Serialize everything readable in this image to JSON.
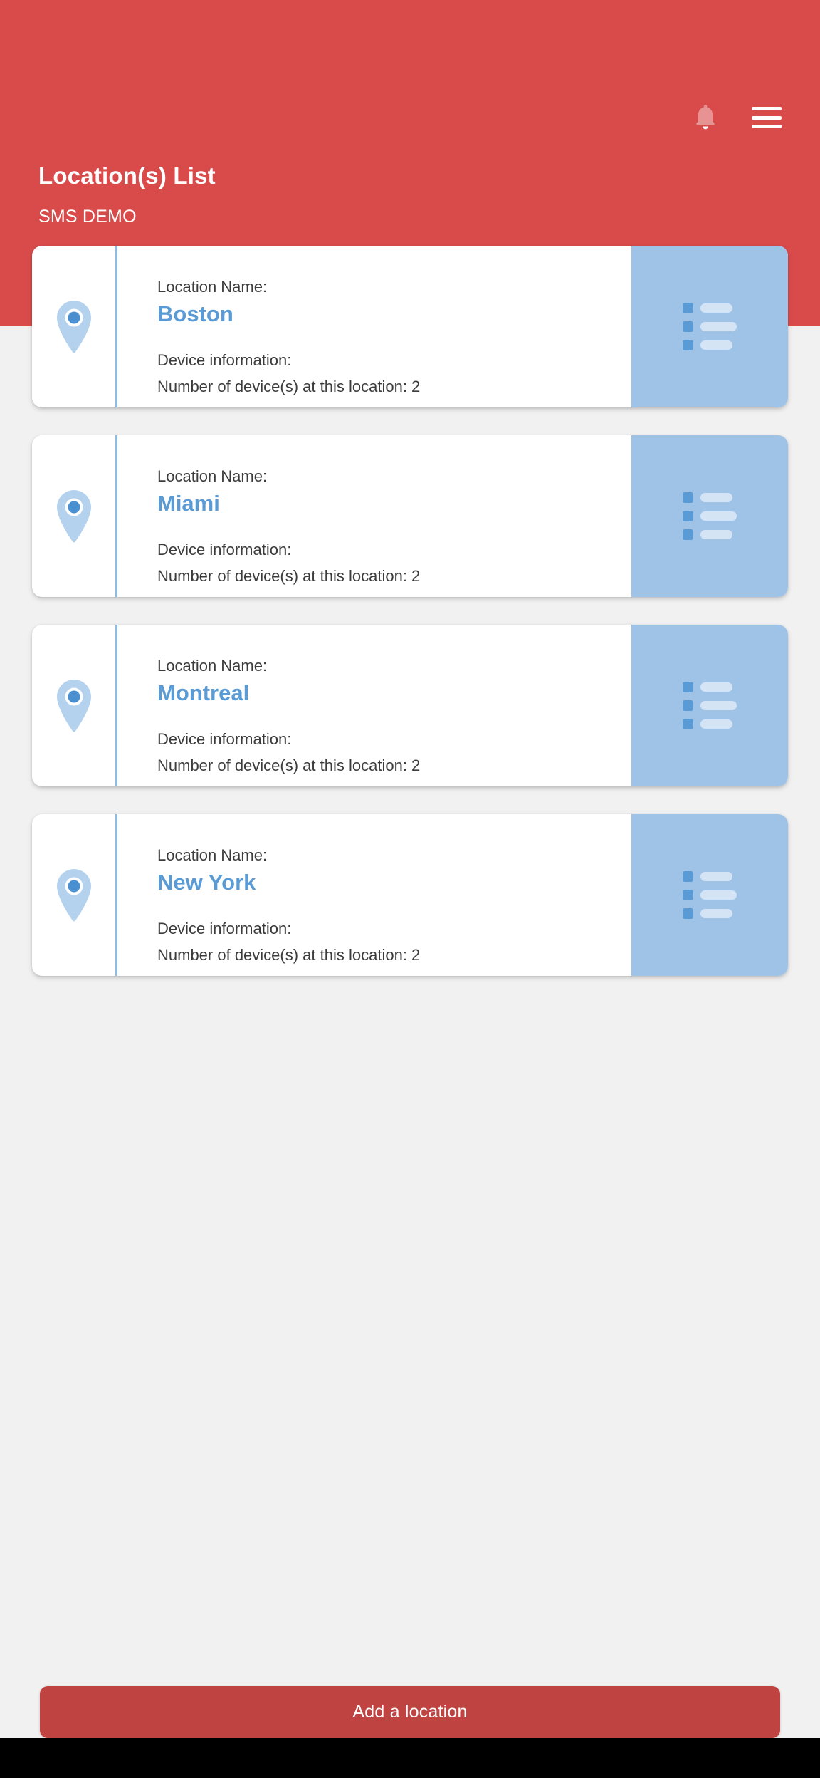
{
  "header": {
    "title": "Location(s) List",
    "subtitle": "SMS DEMO",
    "bell_icon": "bell-icon",
    "menu_icon": "hamburger-menu-icon",
    "color": "#d94b4b"
  },
  "labels": {
    "location_name": "Location Name:",
    "device_information": "Device information:"
  },
  "locations": [
    {
      "name": "Boston",
      "location_name_label": "Location Name:",
      "device_info_label": "Device information:",
      "device_count_text": "Number of device(s) at this location: 2",
      "pin_icon": "map-pin-icon",
      "action_icon": "list-details-icon"
    },
    {
      "name": "Miami",
      "location_name_label": "Location Name:",
      "device_info_label": "Device information:",
      "device_count_text": "Number of device(s) at this location: 2",
      "pin_icon": "map-pin-icon",
      "action_icon": "list-details-icon"
    },
    {
      "name": "Montreal",
      "location_name_label": "Location Name:",
      "device_info_label": "Device information:",
      "device_count_text": "Number of device(s) at this location: 2",
      "pin_icon": "map-pin-icon",
      "action_icon": "list-details-icon"
    },
    {
      "name": "New York",
      "location_name_label": "Location Name:",
      "device_info_label": "Device information:",
      "device_count_text": "Number of device(s) at this location: 2",
      "pin_icon": "map-pin-icon",
      "action_icon": "list-details-icon"
    }
  ],
  "footer": {
    "add_location_label": "Add a location",
    "button_color": "#bf4340"
  },
  "theme": {
    "accent_red": "#d94b4b",
    "accent_blue": "#5b9bd5",
    "panel_blue": "#9ec3e7",
    "pin_light_blue": "#b4d2ee",
    "page_background": "#f1f1f1",
    "card_background": "#ffffff",
    "text_dark": "#3c3c3c",
    "nav_bar": "#000000"
  }
}
